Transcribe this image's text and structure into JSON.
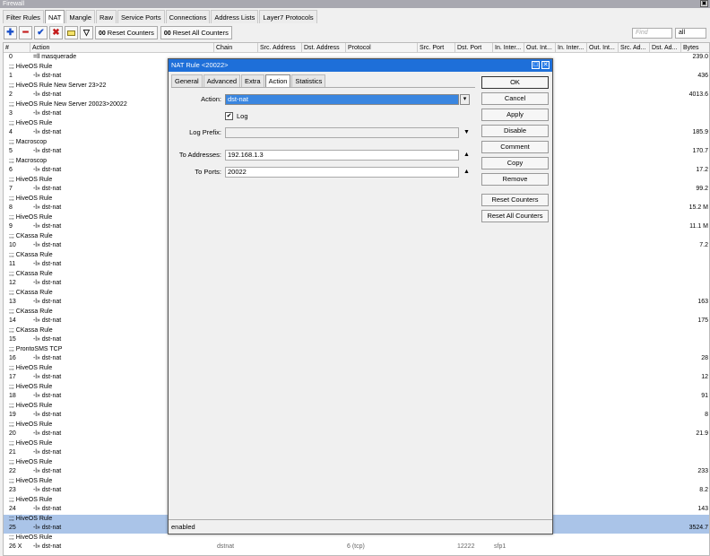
{
  "window": {
    "title": "Firewall"
  },
  "tabs": [
    "Filter Rules",
    "NAT",
    "Mangle",
    "Raw",
    "Service Ports",
    "Connections",
    "Address Lists",
    "Layer7 Protocols"
  ],
  "active_tab": 1,
  "toolbar": {
    "reset_counters": "Reset Counters",
    "reset_all_counters": "Reset All Counters",
    "counter_prefix": "00",
    "find_placeholder": "Find",
    "filter_value": "all"
  },
  "columns": [
    "#",
    "Action",
    "Chain",
    "Src. Address",
    "Dst. Address",
    "Protocol",
    "Src. Port",
    "Dst. Port",
    "In. Inter...",
    "Out. Int...",
    "In. Inter...",
    "Out. Int...",
    "Src. Ad...",
    "Dst. Ad...",
    "Bytes"
  ],
  "rows": [
    {
      "type": "rule",
      "num": "0",
      "action": "masquerade",
      "icon": "=ll",
      "bytes": "239.0",
      "sel": false
    },
    {
      "type": "comment",
      "text": ";;; HiveOS Rule"
    },
    {
      "type": "rule",
      "num": "1",
      "action": "dst-nat",
      "icon": "-l»",
      "bytes": "436",
      "sel": false
    },
    {
      "type": "comment",
      "text": ";;; HiveOS Rule New Server 23>22"
    },
    {
      "type": "rule",
      "num": "2",
      "action": "dst-nat",
      "icon": "-l»",
      "bytes": "4013.6",
      "sel": false
    },
    {
      "type": "comment",
      "text": ";;; HiveOS Rule New Server 20023>20022"
    },
    {
      "type": "rule",
      "num": "3",
      "action": "dst-nat",
      "icon": "-l»",
      "bytes": "",
      "sel": false
    },
    {
      "type": "comment",
      "text": ";;; HiveOS Rule"
    },
    {
      "type": "rule",
      "num": "4",
      "action": "dst-nat",
      "icon": "-l»",
      "bytes": "185.9",
      "sel": false
    },
    {
      "type": "comment",
      "text": ";;; Macroscop"
    },
    {
      "type": "rule",
      "num": "5",
      "action": "dst-nat",
      "icon": "-l»",
      "bytes": "170.7",
      "sel": false
    },
    {
      "type": "comment",
      "text": ";;; Macroscop"
    },
    {
      "type": "rule",
      "num": "6",
      "action": "dst-nat",
      "icon": "-l»",
      "bytes": "17.2",
      "sel": false
    },
    {
      "type": "comment",
      "text": ";;; HiveOS Rule"
    },
    {
      "type": "rule",
      "num": "7",
      "action": "dst-nat",
      "icon": "-l»",
      "bytes": "99.2",
      "sel": false
    },
    {
      "type": "comment",
      "text": ";;; HiveOS Rule"
    },
    {
      "type": "rule",
      "num": "8",
      "action": "dst-nat",
      "icon": "-l»",
      "bytes": "15.2 M",
      "sel": false
    },
    {
      "type": "comment",
      "text": ";;; HiveOS Rule"
    },
    {
      "type": "rule",
      "num": "9",
      "action": "dst-nat",
      "icon": "-l»",
      "bytes": "11.1 M",
      "sel": false
    },
    {
      "type": "comment",
      "text": ";;; CKassa Rule"
    },
    {
      "type": "rule",
      "num": "10",
      "action": "dst-nat",
      "icon": "-l»",
      "bytes": "7.2",
      "sel": false
    },
    {
      "type": "comment",
      "text": ";;; CKassa Rule"
    },
    {
      "type": "rule",
      "num": "11",
      "action": "dst-nat",
      "icon": "-l»",
      "bytes": "",
      "sel": false
    },
    {
      "type": "comment",
      "text": ";;; CKassa Rule"
    },
    {
      "type": "rule",
      "num": "12",
      "action": "dst-nat",
      "icon": "-l»",
      "bytes": "",
      "sel": false
    },
    {
      "type": "comment",
      "text": ";;; CKassa Rule"
    },
    {
      "type": "rule",
      "num": "13",
      "action": "dst-nat",
      "icon": "-l»",
      "bytes": "163",
      "sel": false
    },
    {
      "type": "comment",
      "text": ";;; CKassa Rule"
    },
    {
      "type": "rule",
      "num": "14",
      "action": "dst-nat",
      "icon": "-l»",
      "bytes": "175",
      "sel": false
    },
    {
      "type": "comment",
      "text": ";;; CKassa Rule"
    },
    {
      "type": "rule",
      "num": "15",
      "action": "dst-nat",
      "icon": "-l»",
      "bytes": "",
      "sel": false
    },
    {
      "type": "comment",
      "text": ";;; ProntoSMS TCP"
    },
    {
      "type": "rule",
      "num": "16",
      "action": "dst-nat",
      "icon": "-l»",
      "bytes": "28",
      "sel": false
    },
    {
      "type": "comment",
      "text": ";;; HiveOS Rule"
    },
    {
      "type": "rule",
      "num": "17",
      "action": "dst-nat",
      "icon": "-l»",
      "bytes": "12",
      "sel": false
    },
    {
      "type": "comment",
      "text": ";;; HiveOS Rule"
    },
    {
      "type": "rule",
      "num": "18",
      "action": "dst-nat",
      "icon": "-l»",
      "bytes": "91",
      "sel": false
    },
    {
      "type": "comment",
      "text": ";;; HiveOS Rule"
    },
    {
      "type": "rule",
      "num": "19",
      "action": "dst-nat",
      "icon": "-l»",
      "bytes": "8",
      "sel": false
    },
    {
      "type": "comment",
      "text": ";;; HiveOS Rule"
    },
    {
      "type": "rule",
      "num": "20",
      "action": "dst-nat",
      "icon": "-l»",
      "bytes": "21.9",
      "sel": false
    },
    {
      "type": "comment",
      "text": ";;; HiveOS Rule"
    },
    {
      "type": "rule",
      "num": "21",
      "action": "dst-nat",
      "icon": "-l»",
      "bytes": "",
      "sel": false
    },
    {
      "type": "comment",
      "text": ";;; HiveOS Rule"
    },
    {
      "type": "rule",
      "num": "22",
      "action": "dst-nat",
      "icon": "-l»",
      "bytes": "233",
      "sel": false
    },
    {
      "type": "comment",
      "text": ";;; HiveOS Rule"
    },
    {
      "type": "rule",
      "num": "23",
      "action": "dst-nat",
      "icon": "-l»",
      "bytes": "8.2",
      "sel": false
    },
    {
      "type": "comment",
      "text": ";;; HiveOS Rule"
    },
    {
      "type": "rule",
      "num": "24",
      "action": "dst-nat",
      "icon": "-l»",
      "bytes": "143",
      "sel": false
    },
    {
      "type": "comment",
      "text": ";;; HiveOS Rule",
      "sel": true
    },
    {
      "type": "rule",
      "num": "25",
      "action": "dst-nat",
      "icon": "-l»",
      "bytes": "3524.7",
      "sel": true
    },
    {
      "type": "comment",
      "text": ";;; HiveOS Rule"
    },
    {
      "type": "rule",
      "num": "26 X",
      "action": "dst-nat",
      "icon": "-l»",
      "bytes": "",
      "sel": false,
      "chain": "dstnat",
      "proto": "6 (tcp)",
      "dport": "12222",
      "oint": "sfp1"
    }
  ],
  "dialog": {
    "title": "NAT Rule <20022>",
    "tabs": [
      "General",
      "Advanced",
      "Extra",
      "Action",
      "Statistics"
    ],
    "active_tab": 3,
    "action_label": "Action:",
    "action_value": "dst-nat",
    "log_label": "Log",
    "log_prefix_label": "Log Prefix:",
    "log_prefix_value": "",
    "to_addresses_label": "To Addresses:",
    "to_addresses_value": "192.168.1.3",
    "to_ports_label": "To Ports:",
    "to_ports_value": "20022",
    "buttons": [
      "OK",
      "Cancel",
      "Apply",
      "Disable",
      "Comment",
      "Copy",
      "Remove",
      "Reset Counters",
      "Reset All Counters"
    ],
    "status": "enabled"
  },
  "colors": {
    "selection": "#aac4e8",
    "dialog_title": "#1e6fd9",
    "field_selected": "#3a86e0"
  }
}
